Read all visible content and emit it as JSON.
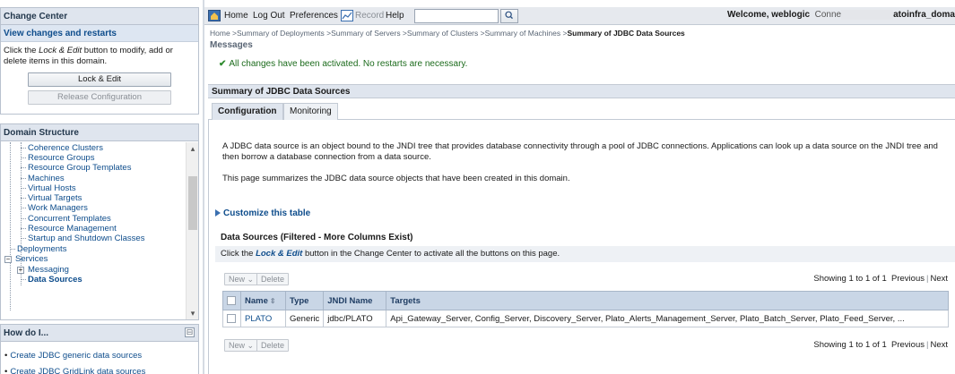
{
  "change_center": {
    "title": "Change Center",
    "subtitle": "View changes and restarts",
    "text_before": "Click the ",
    "text_em": "Lock & Edit",
    "text_after": " button to modify, add or delete items in this domain.",
    "lock_edit_label": "Lock & Edit",
    "release_label": "Release Configuration"
  },
  "domain_structure": {
    "title": "Domain Structure",
    "items": [
      "Coherence Clusters",
      "Resource Groups",
      "Resource Group Templates",
      "Machines",
      "Virtual Hosts",
      "Virtual Targets",
      "Work Managers",
      "Concurrent Templates",
      "Resource Management",
      "Startup and Shutdown Classes",
      "Deployments",
      "Services",
      "Messaging",
      "Data Sources"
    ]
  },
  "how_do_i": {
    "title": "How do I...",
    "collapse_glyph": "⊟",
    "links": [
      "Create JDBC generic data sources",
      "Create JDBC GridLink data sources"
    ]
  },
  "topbar": {
    "home": "Home",
    "logout": "Log Out",
    "preferences": "Preferences",
    "record": "Record",
    "help": "Help",
    "search_value": "",
    "welcome": "Welcome, weblogic",
    "connected_prefix": "Conne",
    "domain_suffix": "atoinfra_doma"
  },
  "breadcrumb": {
    "path": "Home >Summary of Deployments >Summary of Servers >Summary of Clusters >Summary of Machines >",
    "current": "Summary of JDBC Data Sources"
  },
  "messages": {
    "label": "Messages",
    "success": "All changes have been activated. No restarts are necessary."
  },
  "summary": {
    "title": "Summary of JDBC Data Sources",
    "tabs": [
      "Configuration",
      "Monitoring"
    ],
    "description_1": "A JDBC data source is an object bound to the JNDI tree that provides database connectivity through a pool of JDBC connections. Applications can look up a data source on the JNDI tree and then borrow a database connection from a data source.",
    "description_2": "This page summarizes the JDBC data source objects that have been created in this domain.",
    "customize": "Customize this table"
  },
  "data_sources": {
    "title": "Data Sources (Filtered - More Columns Exist)",
    "click_before": "Click the ",
    "click_em": "Lock & Edit",
    "click_after": " button in the Change Center to activate all the buttons on this page.",
    "new_label": "New ⌄",
    "delete_label": "Delete",
    "showing": "Showing 1 to 1 of 1",
    "previous": "Previous",
    "separator": "|",
    "next": "Next",
    "columns": [
      "Name",
      "Type",
      "JNDI Name",
      "Targets"
    ],
    "rows": [
      {
        "name": "PLATO",
        "type": "Generic",
        "jndi": "jdbc/PLATO",
        "targets": "Api_Gateway_Server, Config_Server, Discovery_Server, Plato_Alerts_Management_Server, Plato_Batch_Server, Plato_Feed_Server, ..."
      }
    ]
  }
}
